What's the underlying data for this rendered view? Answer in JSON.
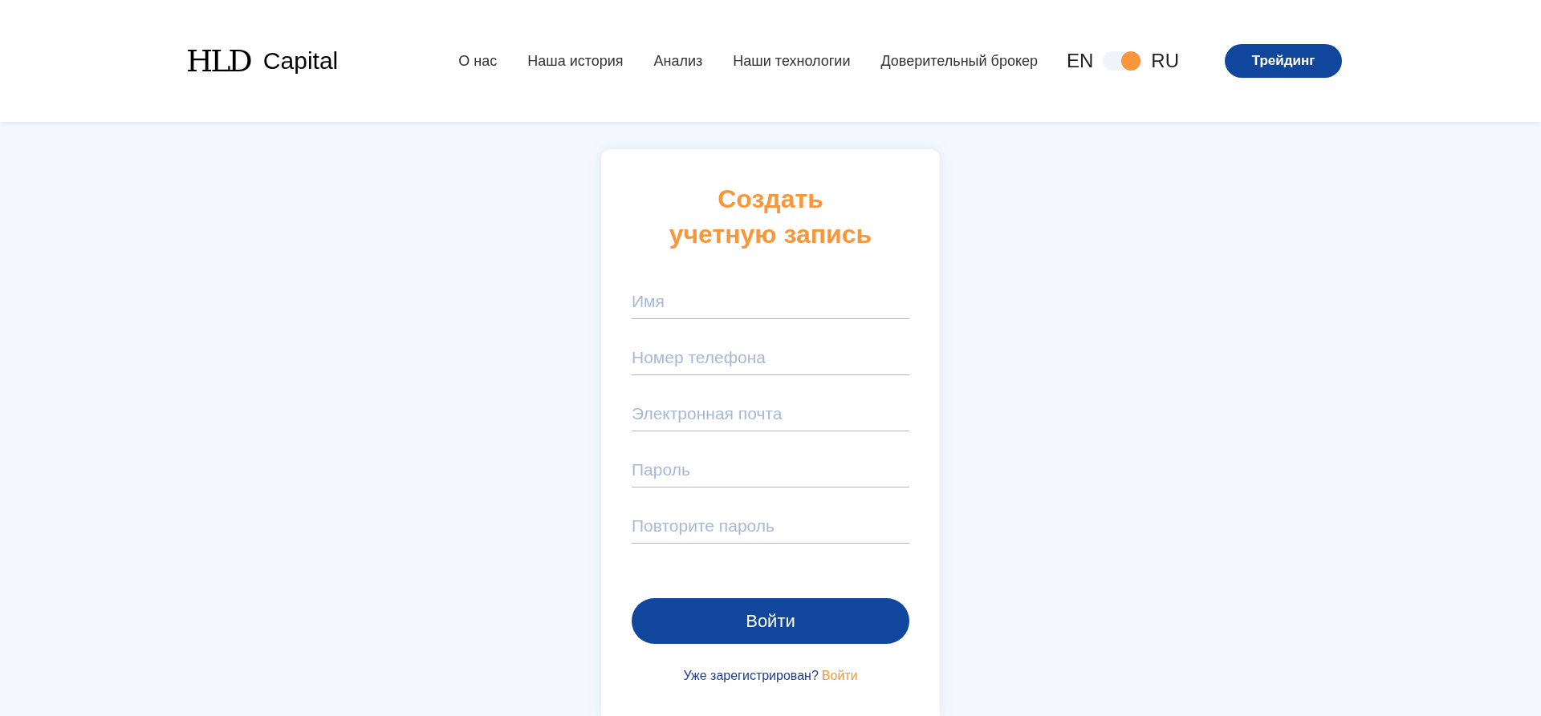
{
  "header": {
    "logo": {
      "mark": "HLD",
      "name": "Capital"
    },
    "nav": [
      {
        "label": "О нас"
      },
      {
        "label": "Наша история"
      },
      {
        "label": "Анализ"
      },
      {
        "label": "Наши технологии"
      },
      {
        "label": "Доверительный брокер"
      }
    ],
    "language": {
      "left": "EN",
      "right": "RU",
      "on": true
    },
    "cta": "Трейдинг"
  },
  "form": {
    "title": "Создать учетную запись",
    "fields": [
      {
        "placeholder": "Имя"
      },
      {
        "placeholder": "Номер телефона"
      },
      {
        "placeholder": "Электронная почта"
      },
      {
        "placeholder": "Пароль"
      },
      {
        "placeholder": "Повторите пароль"
      }
    ],
    "submit": "Войти",
    "footer": {
      "text": "Уже зарегистрирован?",
      "link": "Войти"
    }
  }
}
